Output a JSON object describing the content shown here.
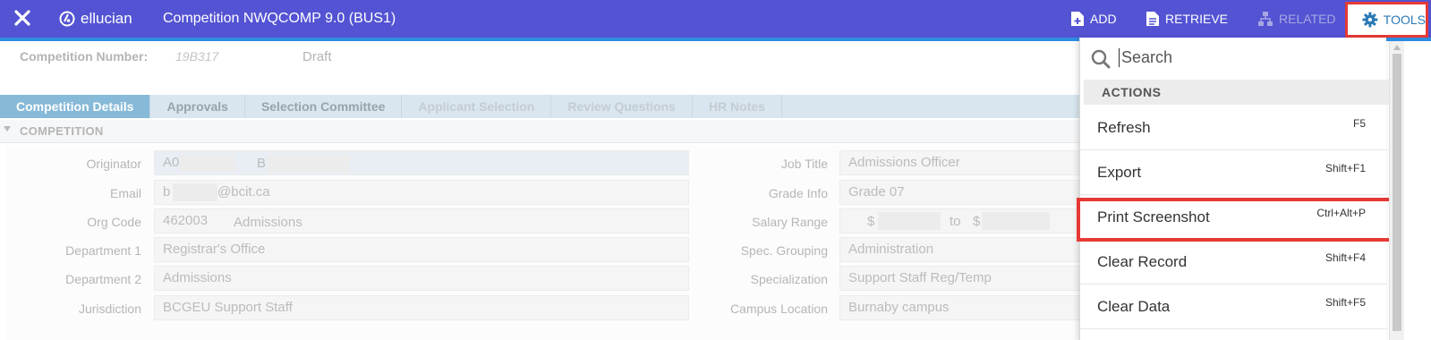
{
  "header": {
    "brand": "ellucian",
    "title": "Competition NWQCOMP 9.0 (BUS1)",
    "nav": {
      "add": "ADD",
      "retrieve": "RETRIEVE",
      "related": "RELATED",
      "tools": "TOOLS"
    }
  },
  "key_block": {
    "label": "Competition Number:",
    "value": "19B317",
    "status": "Draft"
  },
  "tabs": [
    {
      "label": "Competition Details",
      "state": "active"
    },
    {
      "label": "Approvals",
      "state": "enabled"
    },
    {
      "label": "Selection Committee",
      "state": "enabled"
    },
    {
      "label": "Applicant Selection",
      "state": "disabled"
    },
    {
      "label": "Review Questions",
      "state": "disabled"
    },
    {
      "label": "HR Notes",
      "state": "disabled"
    }
  ],
  "section": {
    "title": "COMPETITION"
  },
  "form": {
    "left": [
      {
        "label": "Originator",
        "value": "A0",
        "value2": "B"
      },
      {
        "label": "Email",
        "value": "b",
        "value2": "@bcit.ca"
      },
      {
        "label": "Org Code",
        "value": "462003",
        "value2": "Admissions"
      },
      {
        "label": "Department 1",
        "value": "Registrar's Office"
      },
      {
        "label": "Department 2",
        "value": "Admissions"
      },
      {
        "label": "Jurisdiction",
        "value": "BCGEU Support Staff"
      }
    ],
    "right": [
      {
        "label": "Job Title",
        "value": "Admissions Officer"
      },
      {
        "label": "Grade Info",
        "value": "Grade 07"
      },
      {
        "label": "Salary Range",
        "value": "$",
        "value2": "to",
        "value3": "$"
      },
      {
        "label": "Spec. Grouping",
        "value": "Administration"
      },
      {
        "label": "Specialization",
        "value": "Support Staff Reg/Temp"
      },
      {
        "label": "Campus Location",
        "value": "Burnaby campus"
      }
    ]
  },
  "tools_menu": {
    "search_placeholder": "Search",
    "actions_header": "ACTIONS",
    "items": [
      {
        "label": "Refresh",
        "shortcut": "F5"
      },
      {
        "label": "Export",
        "shortcut": "Shift+F1"
      },
      {
        "label": "Print Screenshot",
        "shortcut": "Ctrl+Alt+P",
        "highlighted": true
      },
      {
        "label": "Clear Record",
        "shortcut": "Shift+F4"
      },
      {
        "label": "Clear Data",
        "shortcut": "Shift+F5"
      }
    ]
  },
  "colors": {
    "topbar": "#5353d3",
    "accent_blue": "#2e8de0",
    "highlight_red": "#e53935",
    "active_tab": "#87b9d8"
  }
}
